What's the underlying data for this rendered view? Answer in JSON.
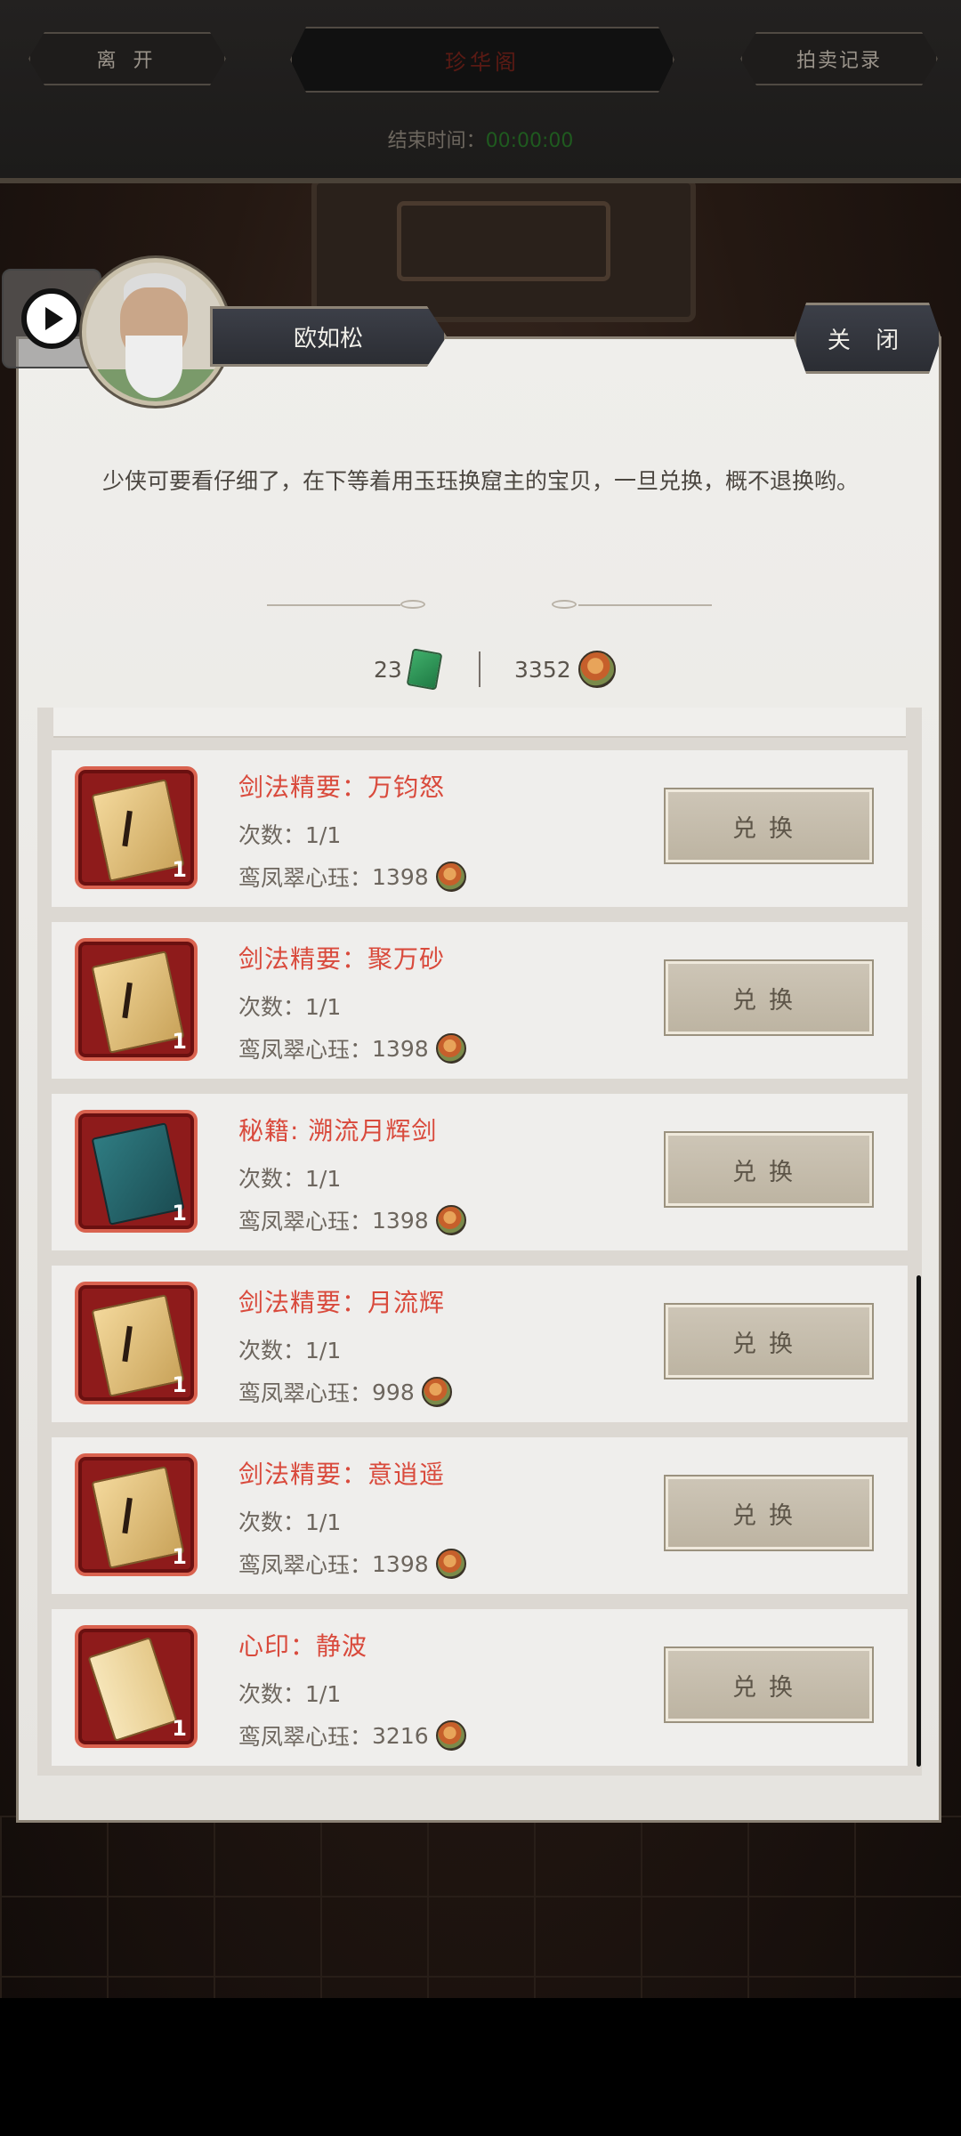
{
  "topbar": {
    "leave_label": "离 开",
    "center_title": "珍华阁",
    "records_label": "拍卖记录",
    "end_time_label": "结束时间：",
    "end_time_value": "00:00:00"
  },
  "npc": {
    "name": "欧如松",
    "close_label": "关 闭",
    "dialog": "少侠可要看仔细了，在下等着用玉珏换窟主的宝贝，一旦兑换，概不退换哟。"
  },
  "currency": {
    "jade_count": "23",
    "coin_count": "3352"
  },
  "items": [
    {
      "title": "剑法精要：万钧怒",
      "times": "次数：1/1",
      "price_label": "鸾凤翠心珏：",
      "price": "1398",
      "count": "1",
      "icon": "book-icon",
      "button": "兑换"
    },
    {
      "title": "剑法精要：聚万砂",
      "times": "次数：1/1",
      "price_label": "鸾凤翠心珏：",
      "price": "1398",
      "count": "1",
      "icon": "book-icon",
      "button": "兑换"
    },
    {
      "title": "秘籍: 溯流月辉剑",
      "times": "次数：1/1",
      "price_label": "鸾凤翠心珏：",
      "price": "1398",
      "count": "1",
      "icon": "teal-book-icon",
      "button": "兑换"
    },
    {
      "title": "剑法精要：月流辉",
      "times": "次数：1/1",
      "price_label": "鸾凤翠心珏：",
      "price": "998",
      "count": "1",
      "icon": "book-icon",
      "button": "兑换"
    },
    {
      "title": "剑法精要：意逍遥",
      "times": "次数：1/1",
      "price_label": "鸾凤翠心珏：",
      "price": "1398",
      "count": "1",
      "icon": "book-icon",
      "button": "兑换"
    },
    {
      "title": "心印：静波",
      "times": "次数：1/1",
      "price_label": "鸾凤翠心珏：",
      "price": "3216",
      "count": "1",
      "icon": "scroll-icon",
      "button": "兑换"
    }
  ],
  "colors": {
    "title_red": "#d94a3c",
    "panel_bg": "#ecebe8",
    "button_bg": "#c6bdac"
  }
}
